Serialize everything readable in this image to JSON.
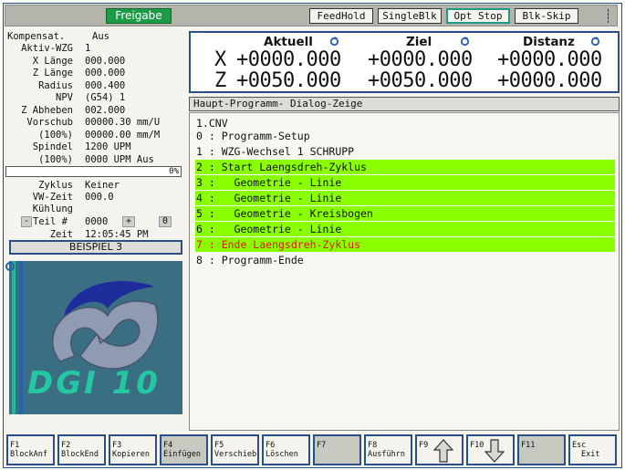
{
  "toolbar": {
    "freigabe": "Freigabe",
    "feedhold": "FeedHold",
    "singleblk": "SingleBlk",
    "optstop": "Opt Stop",
    "blkskip": "Blk-Skip"
  },
  "info": {
    "kompensat_label": "Kompensat.",
    "kompensat_value": "Aus",
    "aktiv_wzg_label": "Aktiv-WZG",
    "aktiv_wzg_value": "1",
    "x_laenge_label": "X Länge",
    "x_laenge_value": "000.000",
    "z_laenge_label": "Z Länge",
    "z_laenge_value": "000.000",
    "radius_label": "Radius",
    "radius_value": "000.400",
    "npv_label": "NPV",
    "npv_value": "(G54) 1",
    "z_abheben_label": "Z Abheben",
    "z_abheben_value": "002.000",
    "vorschub_label": "Vorschub",
    "vorschub_value": "00000.30 mm/U",
    "vorschub_pct_label": "(100%)",
    "vorschub_pct_value": "00000.00 mm/M",
    "spindel_label": "Spindel",
    "spindel_value": "1200 UPM",
    "spindel_pct_label": "(100%)",
    "spindel_pct_value": "0000 UPM Aus",
    "progress_text": "0%",
    "progress_percent": 0,
    "zyklus_label": "Zyklus",
    "zyklus_value": "Keiner",
    "vw_zeit_label": "VW-Zeit",
    "vw_zeit_value": "000.0",
    "kuehlung_label": "Kühlung",
    "teil_minus": "-",
    "teil_label": "Teil #",
    "teil_value": "0000",
    "teil_plus": "+",
    "teil_count": "0",
    "zeit_label": "Zeit",
    "zeit_value": "12:05:45 PM",
    "beispiel": "BEISPIEL 3",
    "logo_text": "DGI 10"
  },
  "position": {
    "headers": {
      "aktuell": "Aktuell",
      "ziel": "Ziel",
      "distanz": "Distanz"
    },
    "x": {
      "axis": "X",
      "aktuell": "+0000.000",
      "ziel": "+0000.000",
      "distanz": "+0000.000"
    },
    "z": {
      "axis": "Z",
      "aktuell": "+0050.000",
      "ziel": "+0050.000",
      "distanz": "+0000.000"
    }
  },
  "program": {
    "title": "Haupt-Programm-  Dialog-Zeige",
    "filename": "1.CNV",
    "lines": [
      "0 : Programm-Setup",
      "1 : WZG-Wechsel 1 SCHRUPP",
      "2 : Start Laengsdreh-Zyklus",
      "3 :   Geometrie - Linie",
      "4 :   Geometrie - Linie",
      "5 :   Geometrie - Kreisbogen",
      "6 :   Geometrie - Linie",
      "7 : Ende Laengsdreh-Zyklus",
      "8 : Programm-Ende"
    ]
  },
  "fkeys": [
    {
      "key": "F1",
      "label": "BlockAnf"
    },
    {
      "key": "F2",
      "label": "BlockEnd"
    },
    {
      "key": "F3",
      "label": "Kopieren"
    },
    {
      "key": "F4",
      "label": "Einfügen"
    },
    {
      "key": "F5",
      "label": "Verschieb"
    },
    {
      "key": "F6",
      "label": "Löschen"
    },
    {
      "key": "F7",
      "label": ""
    },
    {
      "key": "F8",
      "label": "Ausführn"
    },
    {
      "key": "F9",
      "label": ""
    },
    {
      "key": "F10",
      "label": ""
    },
    {
      "key": "F11",
      "label": ""
    },
    {
      "key": "Esc",
      "label": "Exit"
    }
  ],
  "colors": {
    "highlight": "#8aff00",
    "active_green": "#1e9b46",
    "border_blue": "#2a4f87",
    "error_red": "#e01515"
  }
}
